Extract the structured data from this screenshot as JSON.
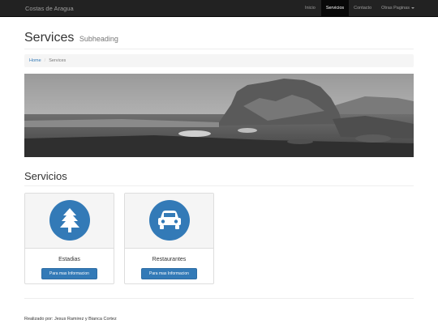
{
  "navbar": {
    "brand": "Costas de Aragua",
    "items": [
      {
        "label": "Inicio",
        "active": false
      },
      {
        "label": "Servicios",
        "active": true
      },
      {
        "label": "Contacto",
        "active": false
      },
      {
        "label": "Otras Paginas",
        "active": false,
        "dropdown": true
      }
    ]
  },
  "header": {
    "title": "Services",
    "subtitle": "Subheading"
  },
  "breadcrumb": {
    "home": "Home",
    "separator": "/",
    "current": "Services"
  },
  "section": {
    "title": "Servicios"
  },
  "cards": [
    {
      "title": "Estadias",
      "button": "Para mas Informacion",
      "icon": "tree-icon"
    },
    {
      "title": "Restaurantes",
      "button": "Para mas Informacion",
      "icon": "car-icon"
    }
  ],
  "footer": {
    "text": "Realizado por: Jesus Ramirez y Bianca Cortez"
  },
  "colors": {
    "navbar_bg": "#222222",
    "accent": "#337ab7",
    "panel_bg": "#f5f5f5"
  }
}
